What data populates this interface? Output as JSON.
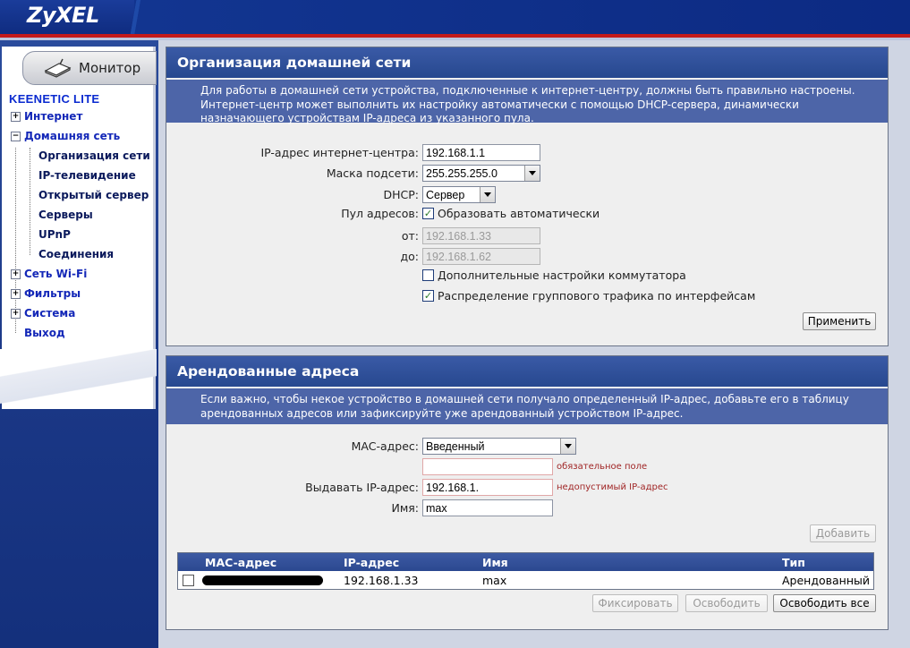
{
  "header": {
    "logo": "ZyXEL"
  },
  "nav": {
    "tab_label": "Монитор",
    "device": "KEENETIC LITE",
    "items": [
      {
        "label": "Интернет",
        "expander": "+"
      },
      {
        "label": "Домашняя сеть",
        "expander": "−"
      },
      {
        "label": "Сеть Wi-Fi",
        "expander": "+"
      },
      {
        "label": "Фильтры",
        "expander": "+"
      },
      {
        "label": "Система",
        "expander": "+"
      },
      {
        "label": "Выход",
        "expander": ""
      }
    ],
    "subitems": [
      {
        "label": "Организация сети"
      },
      {
        "label": "IP-телевидение"
      },
      {
        "label": "Открытый сервер"
      },
      {
        "label": "Серверы"
      },
      {
        "label": "UPnP"
      },
      {
        "label": "Соединения"
      }
    ]
  },
  "home": {
    "title": "Организация домашней сети",
    "description": "Для работы в домашней сети устройства, подключенные к интернет-центру, должны быть правильно настроены. Интернет-центр может выполнить их настройку автоматически с помощью DHCP-сервера, динамически назначающего устройствам IP-адреса из указанного пула.",
    "ip_label": "IP-адрес интернет-центра:",
    "ip_value": "192.168.1.1",
    "mask_label": "Маска подсети:",
    "mask_value": "255.255.255.0",
    "dhcp_label": "DHCP:",
    "dhcp_value": "Сервер",
    "pool_label": "Пул адресов:",
    "pool_auto_label": "Образовать автоматически",
    "pool_auto_checked": "✓",
    "from_label": "от:",
    "from_value": "192.168.1.33",
    "to_label": "до:",
    "to_value": "192.168.1.62",
    "switch_label": "Дополнительные настройки коммутатора",
    "multicast_label": "Распределение группового трафика по интерфейсам",
    "multicast_checked": "✓",
    "apply_label": "Применить"
  },
  "leases": {
    "title": "Арендованные адреса",
    "description": "Если важно, чтобы некое устройство в домашней сети получало определенный IP-адрес, добавьте его в таблицу арендованных адресов или зафиксируйте уже арендованный устройством IP-адрес.",
    "mac_label": "MAC-адрес:",
    "mac_mode": "Введенный",
    "mac_value": "",
    "mac_hint": "обязательное поле",
    "ip_label": "Выдавать IP-адрес:",
    "ip_value": "192.168.1.",
    "ip_hint": "недопустимый IP-адрес",
    "name_label": "Имя:",
    "name_value": "max",
    "add_label": "Добавить",
    "table": {
      "columns": [
        "MAC-адрес",
        "IP-адрес",
        "Имя",
        "Тип"
      ],
      "rows": [
        {
          "mac": "",
          "ip": "192.168.1.33",
          "name": "max",
          "type": "Арендованный"
        }
      ]
    },
    "fix_label": "Фиксировать",
    "release_label": "Освободить",
    "release_all_label": "Освободить все"
  }
}
